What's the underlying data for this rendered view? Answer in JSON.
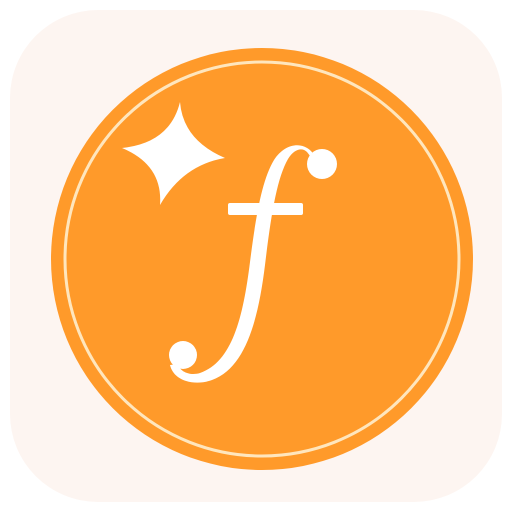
{
  "app_icon": {
    "glyph": "f",
    "colors": {
      "background": "#ffffff",
      "tile": "#fdf5f1",
      "coin": "#ff9a2a",
      "coin_ring": "#ffe6bd",
      "glyph": "#ffffff",
      "sparkle": "#ffffff"
    },
    "icons": [
      "sparkle-icon",
      "function-f-icon"
    ]
  }
}
